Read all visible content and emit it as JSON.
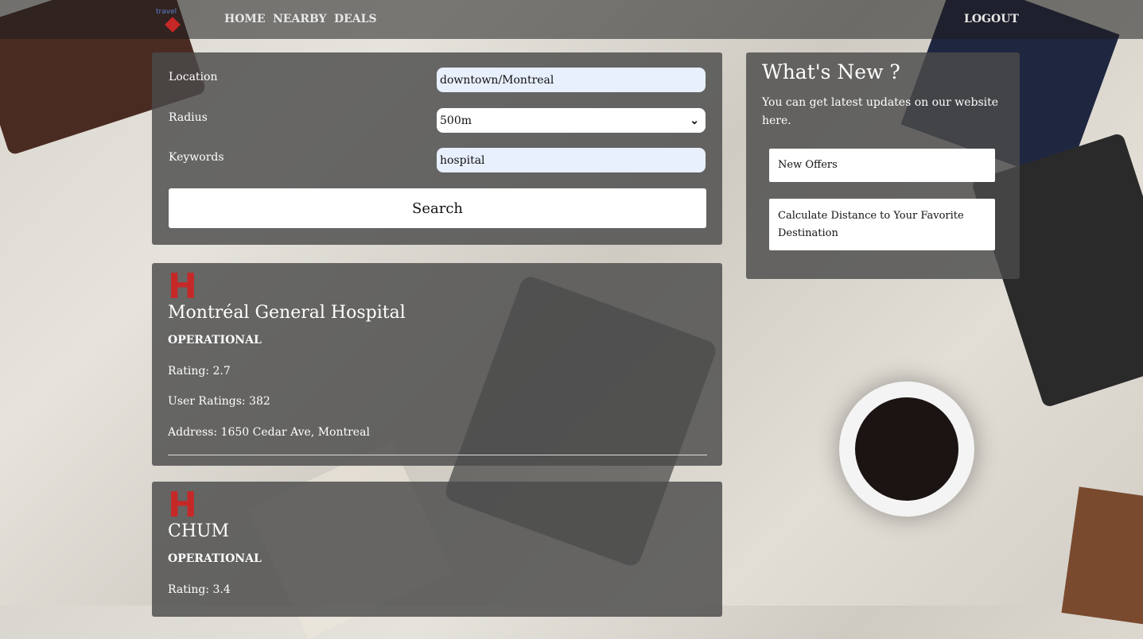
{
  "nav": {
    "logo_text": "travel",
    "links": [
      "HOME",
      "NEARBY",
      "DEALS"
    ],
    "logout": "LOGOUT"
  },
  "search": {
    "location_label": "Location",
    "location_value": "downtown/Montreal",
    "radius_label": "Radius",
    "radius_value": "500m",
    "keywords_label": "Keywords",
    "keywords_value": "hospital",
    "button": "Search"
  },
  "news": {
    "title": "What's New ?",
    "subtitle": "You can get latest updates on our website here.",
    "items": [
      "New Offers",
      "Calculate Distance to Your Favorite Destination"
    ]
  },
  "results": [
    {
      "icon": "H",
      "name": "Montréal General Hospital",
      "status": "OPERATIONAL",
      "rating": "Rating: 2.7",
      "user_ratings": "User Ratings: 382",
      "address": "Address: 1650 Cedar Ave, Montreal"
    },
    {
      "icon": "H",
      "name": "CHUM",
      "status": "OPERATIONAL",
      "rating": "Rating: 3.4"
    }
  ],
  "colors": {
    "accent": "#c62828",
    "panel": "#4b4b4b",
    "field": "#e8f0fe"
  }
}
